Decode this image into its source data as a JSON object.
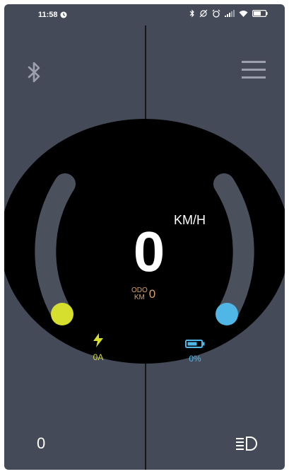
{
  "status_bar": {
    "time": "11:58",
    "battery_level": "58"
  },
  "speedometer": {
    "speed": "0",
    "unit": "KM/H"
  },
  "odometer": {
    "label_top": "ODO",
    "label_bottom": "KM",
    "value": "0"
  },
  "current": {
    "value": "0A"
  },
  "battery": {
    "value": "0%"
  },
  "bottom_left": {
    "value": "0"
  },
  "icons": {
    "bluetooth": "bluetooth-icon",
    "menu": "menu-icon",
    "current": "lightning-icon",
    "battery": "battery-icon",
    "headlight": "headlight-icon"
  },
  "colors": {
    "background": "#444a58",
    "dial": "#000000",
    "left_indicator": "#d6de2e",
    "right_indicator": "#4fb6e6",
    "odometer": "#d9a066",
    "arc_track": "#4a505c"
  }
}
